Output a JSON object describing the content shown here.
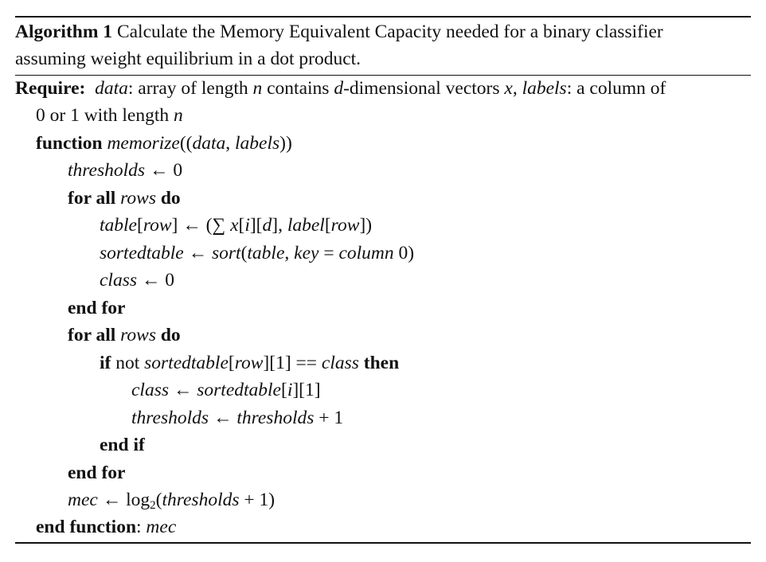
{
  "caption": {
    "label": "Algorithm 1",
    "text_line1": "Calculate the Memory Equivalent Capacity needed for a binary classifier",
    "text_line2": "assuming weight equilibrium in a dot product."
  },
  "require": {
    "keyword": "Require:",
    "data_var": "data",
    "t1": ": array of length ",
    "n1": "n",
    "t2": " contains ",
    "d1": "d",
    "t3": "-dimensional vectors ",
    "x1": "x",
    "t4": ", ",
    "labels_var": "labels",
    "t5": ": a column of",
    "line2_text": "0 or 1 with length ",
    "n2": "n"
  },
  "function_line": {
    "keyword": "function",
    "name": "memorize",
    "p_open": "((",
    "arg1": "data",
    "comma": ", ",
    "arg2": "labels",
    "p_close": "))"
  },
  "init_line": {
    "var": "thresholds",
    "op": " ← 0"
  },
  "for1": {
    "kw_for": "for all",
    "var": "rows",
    "kw_do": "do"
  },
  "table_line": {
    "var": "table",
    "b1": "[",
    "idx": "row",
    "b2": "] ← (∑ ",
    "x": "x",
    "b3": "[",
    "i": "i",
    "b4": "][",
    "d": "d",
    "b5": "], ",
    "label": "label",
    "b6": "[",
    "row2": "row",
    "b7": "])"
  },
  "sorted_line": {
    "var": "sortedtable",
    "arrow": " ← ",
    "fn": "sort",
    "p1": "(",
    "arg": "table",
    "comma": ", ",
    "key": "key",
    "eq": " = ",
    "col": "column",
    "tail": " 0)"
  },
  "class_line": {
    "var": "class",
    "op": " ← 0"
  },
  "endfor1": "end for",
  "for2": {
    "kw_for": "for all",
    "var": "rows",
    "kw_do": "do"
  },
  "if_line": {
    "kw_if": "if",
    "not": " not ",
    "var": "sortedtable",
    "b1": "[",
    "row": "row",
    "b2": "][1] == ",
    "cls": "class",
    "kw_then": "then"
  },
  "class_assign": {
    "var": "class",
    "arrow": " ← ",
    "src": "sortedtable",
    "b1": "[",
    "i": "i",
    "b2": "][1]"
  },
  "thresh_inc": {
    "var": "thresholds",
    "arrow": " ← ",
    "var2": "thresholds",
    "tail": " + 1"
  },
  "endif": "end if",
  "endfor2": "end for",
  "mec_line": {
    "var": "mec",
    "arrow": " ← log",
    "sub": "2",
    "p": "(",
    "var2": "thresholds",
    "tail": " + 1)"
  },
  "end_function": {
    "keyword": "end function",
    "colon": ": ",
    "ret": "mec"
  }
}
